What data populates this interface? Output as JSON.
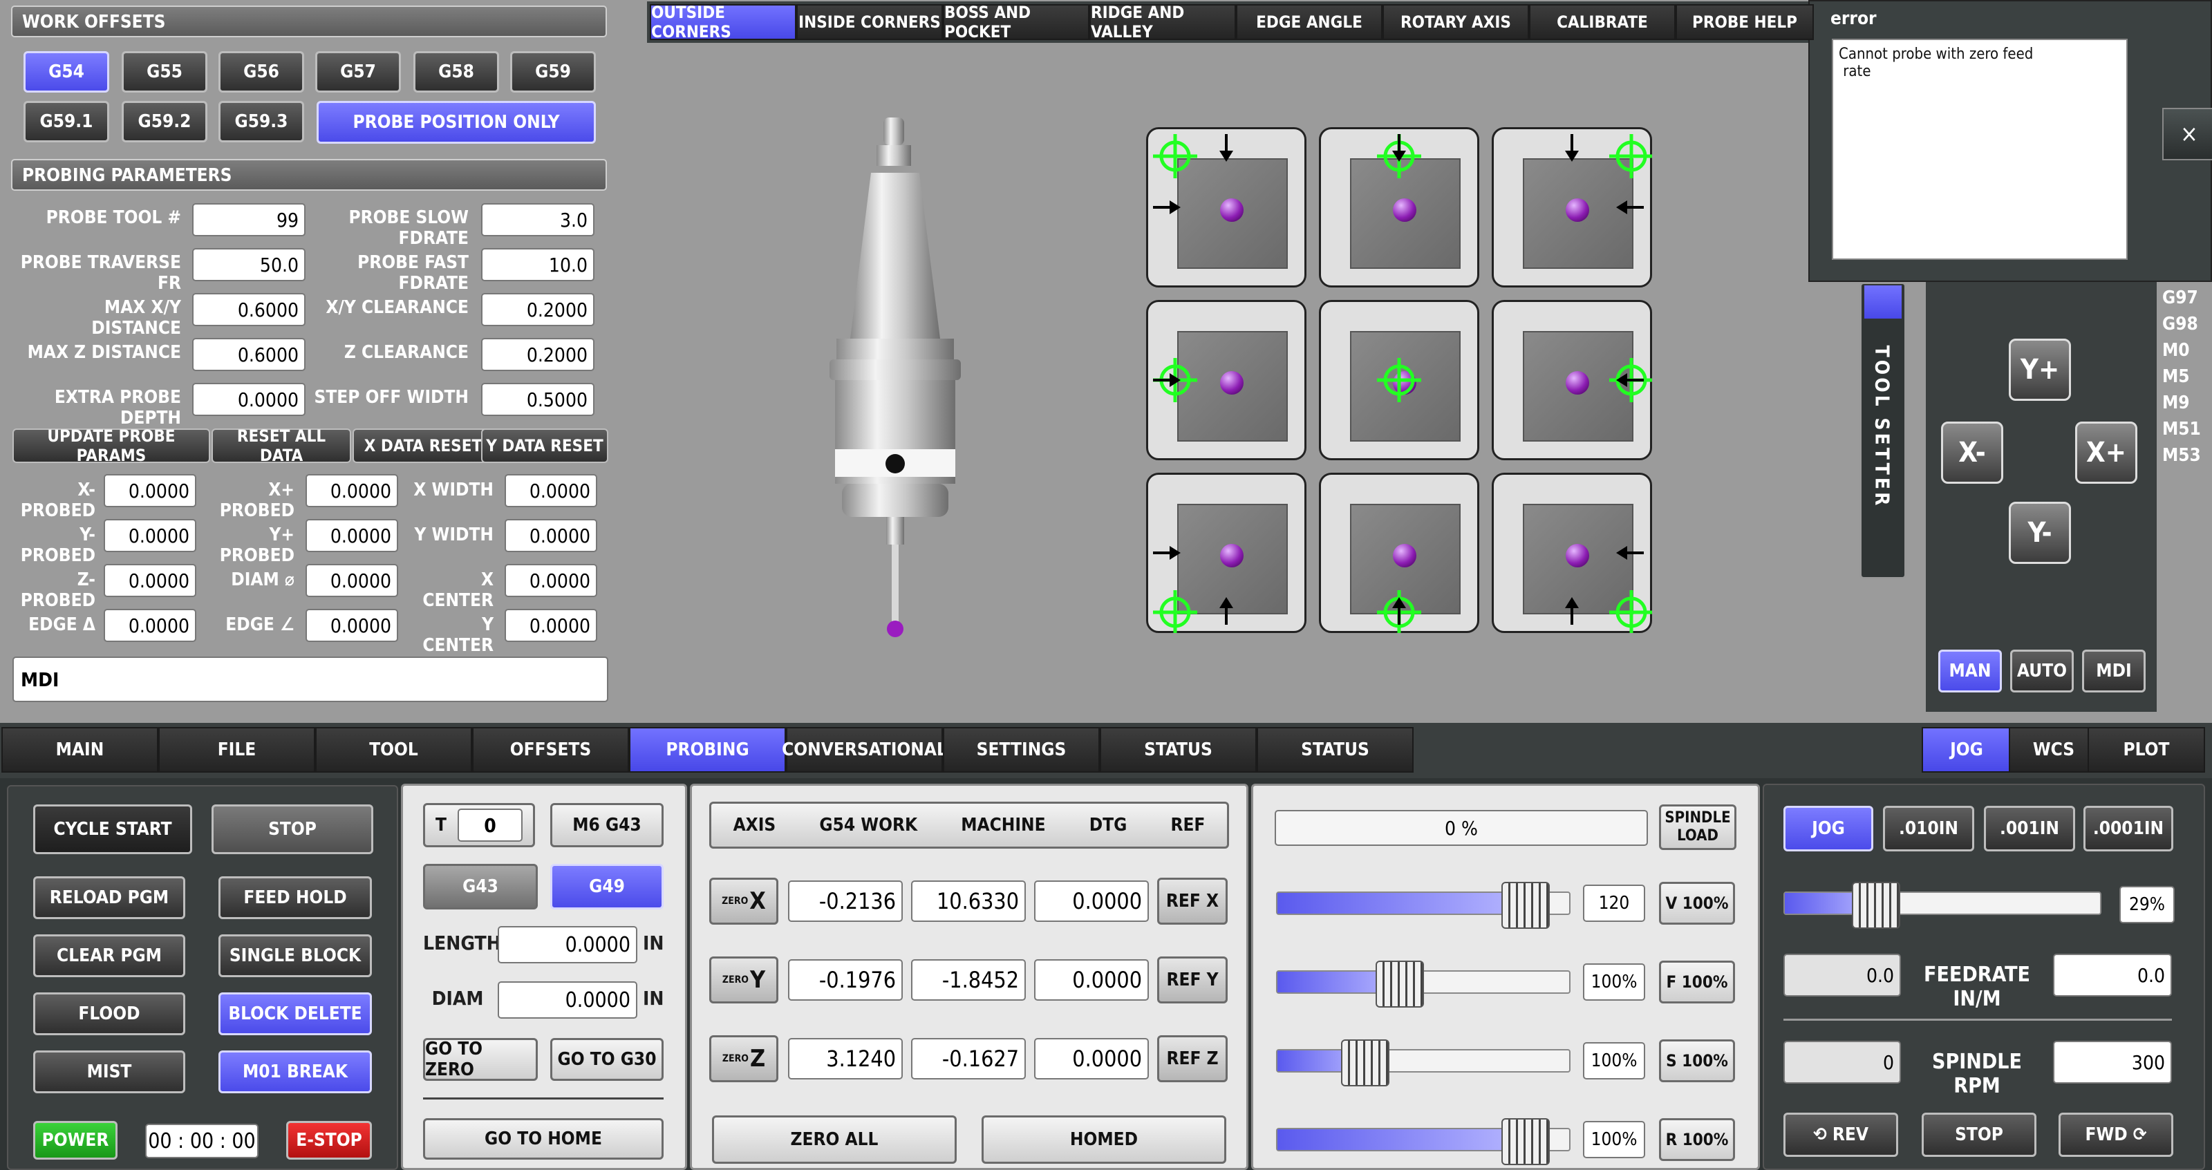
{
  "work_offsets": {
    "title": "WORK OFFSETS",
    "buttons": [
      "G54",
      "G55",
      "G56",
      "G57",
      "G58",
      "G59",
      "G59.1",
      "G59.2",
      "G59.3"
    ],
    "probe_position_only": "PROBE POSITION ONLY",
    "selected": "G54"
  },
  "probing_params": {
    "title": "PROBING PARAMETERS",
    "rows": [
      {
        "l1": "PROBE TOOL #",
        "v1": "99",
        "l2": "PROBE SLOW FDRATE",
        "v2": "3.0"
      },
      {
        "l1": "PROBE TRAVERSE FR",
        "v1": "50.0",
        "l2": "PROBE FAST FDRATE",
        "v2": "10.0"
      },
      {
        "l1": "MAX X/Y DISTANCE",
        "v1": "0.6000",
        "l2": "X/Y CLEARANCE",
        "v2": "0.2000"
      },
      {
        "l1": "MAX Z DISTANCE",
        "v1": "0.6000",
        "l2": "Z CLEARANCE",
        "v2": "0.2000"
      },
      {
        "l1": "EXTRA PROBE DEPTH",
        "v1": "0.0000",
        "l2": "STEP OFF WIDTH",
        "v2": "0.5000"
      }
    ],
    "actions": [
      "UPDATE PROBE PARAMS",
      "RESET ALL DATA",
      "X DATA RESET",
      "Y DATA RESET"
    ]
  },
  "results": [
    {
      "l1": "X- PROBED",
      "v1": "0.0000",
      "l2": "X+ PROBED",
      "v2": "0.0000",
      "l3": "X WIDTH",
      "v3": "0.0000"
    },
    {
      "l1": "Y- PROBED",
      "v1": "0.0000",
      "l2": "Y+ PROBED",
      "v2": "0.0000",
      "l3": "Y WIDTH",
      "v3": "0.0000"
    },
    {
      "l1": "Z- PROBED",
      "v1": "0.0000",
      "l2": "DIAM ⌀",
      "v2": "0.0000",
      "l3": "X CENTER",
      "v3": "0.0000"
    },
    {
      "l1": "EDGE Δ",
      "v1": "0.0000",
      "l2": "EDGE ∠",
      "v2": "0.0000",
      "l3": "Y CENTER",
      "v3": "0.0000"
    }
  ],
  "mdi": {
    "value": "MDI"
  },
  "probe_tabs": [
    "OUTSIDE CORNERS",
    "INSIDE CORNERS",
    "BOSS AND POCKET",
    "RIDGE AND VALLEY",
    "EDGE ANGLE",
    "ROTARY AXIS",
    "CALIBRATE",
    "PROBE HELP"
  ],
  "probe_tab_selected": "OUTSIDE CORNERS",
  "error": {
    "title": "error",
    "message": "Cannot probe with zero feed\n rate",
    "close": "×"
  },
  "tool_setter": "TOOL SETTER",
  "gcodes": [
    "G97",
    "G98",
    "M0",
    "M5",
    "M9",
    "M51",
    "M53"
  ],
  "jog_keys": {
    "yp": "Y+",
    "ym": "Y-",
    "xm": "X-",
    "xp": "X+"
  },
  "modes": [
    "MAN",
    "AUTO",
    "MDI"
  ],
  "main_tabs": [
    "MAIN",
    "FILE",
    "TOOL",
    "OFFSETS",
    "PROBING",
    "CONVERSATIONAL",
    "SETTINGS",
    "STATUS",
    "STATUS"
  ],
  "main_tab_selected": "PROBING",
  "right_tabs": [
    "JOG",
    "WCS",
    "PLOT"
  ],
  "controls": {
    "cycle_start": "CYCLE START",
    "stop": "STOP",
    "reload": "RELOAD PGM",
    "feed_hold": "FEED HOLD",
    "clear": "CLEAR PGM",
    "single_block": "SINGLE BLOCK",
    "flood": "FLOOD",
    "block_delete": "BLOCK DELETE",
    "mist": "MIST",
    "m01": "M01 BREAK",
    "power": "POWER",
    "timer": "00 : 00 : 00",
    "estop": "E-STOP"
  },
  "tool": {
    "t_label": "T",
    "t_value": "0",
    "m6": "M6 G43",
    "g43": "G43",
    "g49": "G49",
    "length_label": "LENGTH",
    "length": "0.0000",
    "diam_label": "DIAM",
    "diam": "0.0000",
    "unit": "IN",
    "go_zero": "GO TO ZERO",
    "go_g30": "GO TO G30",
    "go_home": "GO TO HOME"
  },
  "dro": {
    "headers": [
      "AXIS",
      "G54 WORK",
      "MACHINE",
      "DTG",
      "REF"
    ],
    "zero_label": "ZERO",
    "rows": [
      {
        "axis": "X",
        "work": "-0.2136",
        "machine": "10.6330",
        "dtg": "0.0000",
        "ref": "REF X"
      },
      {
        "axis": "Y",
        "work": "-0.1976",
        "machine": "-1.8452",
        "dtg": "0.0000",
        "ref": "REF Y"
      },
      {
        "axis": "Z",
        "work": "3.1240",
        "machine": "-0.1627",
        "dtg": "0.0000",
        "ref": "REF Z"
      }
    ],
    "zero_all": "ZERO ALL",
    "homed": "HOMED"
  },
  "overrides": {
    "load": "0 %",
    "spindle_load": "SPINDLE\nLOAD",
    "rows": [
      {
        "pct": "120",
        "btn": "V 100%",
        "fill": 0.85
      },
      {
        "pct": "100%",
        "btn": "F 100%",
        "fill": 0.42
      },
      {
        "pct": "100%",
        "btn": "S 100%",
        "fill": 0.3
      },
      {
        "pct": "100%",
        "btn": "R 100%",
        "fill": 0.85
      }
    ]
  },
  "jog_panel": {
    "jog": "JOG",
    "inc": [
      ".010IN",
      ".001IN",
      ".0001IN"
    ],
    "jog_pct": "29%",
    "jog_fill": 0.29,
    "feed_left": "0.0",
    "feed_label": "FEEDRATE IN/M",
    "feed_right": "0.0",
    "rpm_left": "0",
    "rpm_label": "SPINDLE RPM",
    "rpm_right": "300",
    "rev": "⟲ REV",
    "stop": "STOP",
    "fwd": "FWD ⟳"
  }
}
